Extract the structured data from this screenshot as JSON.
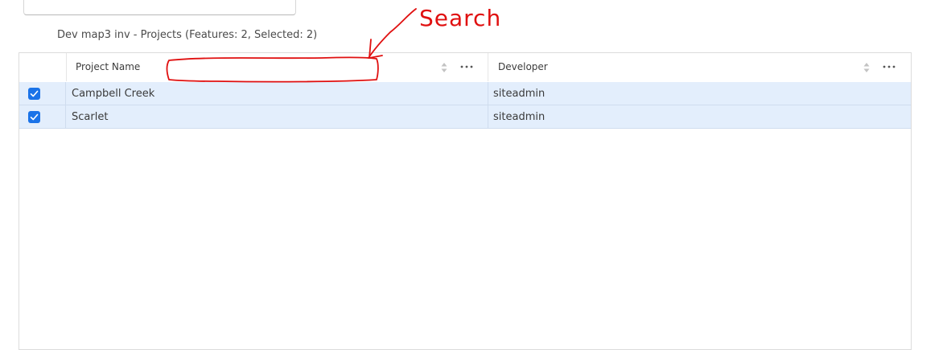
{
  "layer_title": "Dev map3 inv - Projects (Features: 2, Selected: 2)",
  "columns": [
    {
      "label": "Project Name"
    },
    {
      "label": "Developer"
    }
  ],
  "rows": [
    {
      "project_name": "Campbell Creek",
      "developer": "siteadmin",
      "selected": true
    },
    {
      "project_name": "Scarlet",
      "developer": "siteadmin",
      "selected": true
    }
  ],
  "annotation": {
    "label": "Search",
    "color": "#e01010"
  },
  "colors": {
    "selected_row": "#e3eefc",
    "checkbox": "#1a73e8"
  },
  "icons": [
    "sort-icon",
    "more-options-icon",
    "checkmark-icon"
  ]
}
